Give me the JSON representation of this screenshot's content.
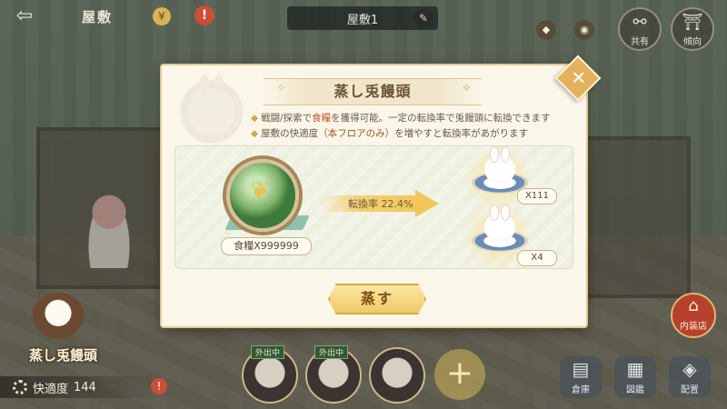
{
  "topbar": {
    "back_glyph": "⇦",
    "house_label": "屋敷",
    "floor_label": "屋敷1",
    "top_buttons": [
      {
        "label": "共有",
        "glyph": "⚯"
      },
      {
        "label": "傾向",
        "glyph": "⛩"
      }
    ]
  },
  "modal": {
    "title": "蒸し兎饅頭",
    "close_glyph": "✕",
    "desc_line1_pre": "戦闘/探索で",
    "desc_line1_hl": "食糧",
    "desc_line1_post": "を獲得可能。一定の転換率で兎饅頭に転換できます",
    "desc_line2_pre": "屋敷の快適度",
    "desc_line2_hl": "（本フロアのみ）",
    "desc_line2_post": "を増やすと転換率があがります",
    "input_label": "食糧X999999",
    "rate_label": "転換率 22.4%",
    "outputs": [
      {
        "qty": "X111"
      },
      {
        "qty": "X4"
      }
    ],
    "action_label": "蒸す"
  },
  "left_panel": {
    "item_name": "蒸し兎饅頭",
    "comfort_label": "快適度",
    "comfort_value": "144"
  },
  "bottom": {
    "slot_tag": "外出中",
    "add_glyph": "+",
    "buttons": [
      {
        "label": "倉庫",
        "glyph": "▤"
      },
      {
        "label": "図鑑",
        "glyph": "▦"
      },
      {
        "label": "配置",
        "glyph": "◈"
      }
    ],
    "shop_label": "内装店",
    "shop_glyph": "⌂"
  },
  "colors": {
    "accent_gold": "#e2b25c",
    "panel_bg": "#fbf6ea",
    "highlight_red": "#c4552f"
  }
}
